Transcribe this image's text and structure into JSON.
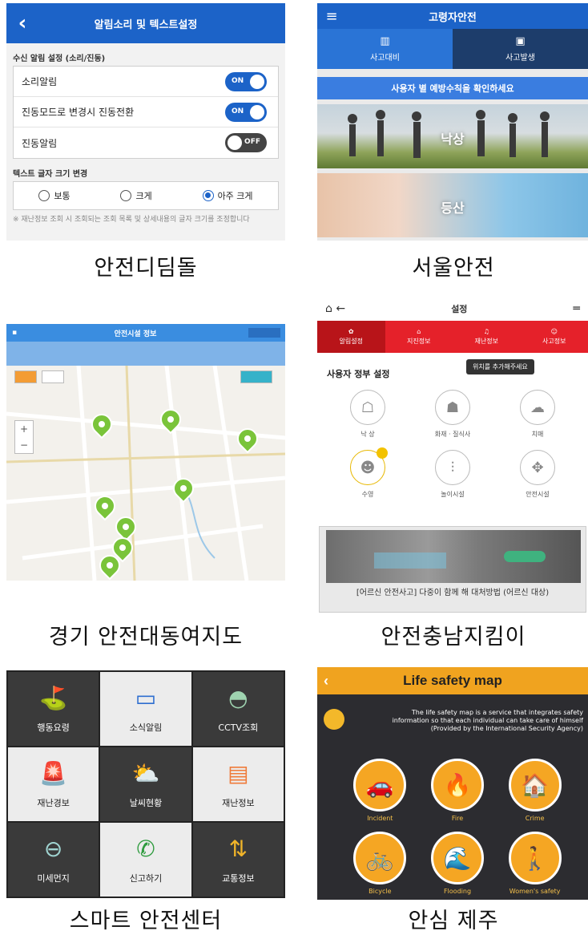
{
  "captions": {
    "p1": "안전디딤돌",
    "p2": "서울안전",
    "p3": "경기 안전대동여지도",
    "p4": "안전충남지킴이",
    "p5": "스마트 안전센터",
    "p6": "안심 제주"
  },
  "p1": {
    "title": "알림소리 및 텍스트설정",
    "section1": "수신 알림 설정 (소리/진동)",
    "rows": [
      {
        "label": "소리알림",
        "state": "ON"
      },
      {
        "label": "진동모드로 변경시 진동전환",
        "state": "ON"
      },
      {
        "label": "진동알림",
        "state": "OFF"
      }
    ],
    "section2": "텍스트 글자 크기 변경",
    "radios": [
      "보통",
      "크게",
      "아주 크게"
    ],
    "note": "※ 재난정보 조회 시 조회되는 조회 목록 및 상세내용의 글자 크기를 조정합니다"
  },
  "p2": {
    "title": "고령자안전",
    "tabs": [
      "사고대비",
      "사고발생"
    ],
    "notice": "사용자 별 예방수칙을 확인하세요",
    "cards": [
      "낙상",
      "등산"
    ]
  },
  "p3": {
    "title": "안전시설 정보"
  },
  "p4": {
    "title": "설정",
    "menu": [
      "알림설정",
      "지진정보",
      "재난정보",
      "사고정보"
    ],
    "tooltip": "위치를 추가해주세요",
    "heading": "사용자 정부 설정",
    "items": [
      "낙 상",
      "화재 · 질식사",
      "치매",
      "수영",
      "놀이시설",
      "안전시설"
    ],
    "photo_caption": "[어르신 안전사고] 다중이 함께 해 대처방법 (어르신 대상)"
  },
  "p5": {
    "tiles": [
      {
        "label": "행동요령",
        "icon": "map-pin-icon",
        "glyph": "⛳",
        "color": "#43a047",
        "style": "dark"
      },
      {
        "label": "소식알림",
        "icon": "card-icon",
        "glyph": "▭",
        "color": "#2f6fd0",
        "style": "light"
      },
      {
        "label": "CCTV조회",
        "icon": "cctv-icon",
        "glyph": "◓",
        "color": "#9fd3b0",
        "style": "dark"
      },
      {
        "label": "재난경보",
        "icon": "siren-icon",
        "glyph": "🚨",
        "color": "#e53935",
        "style": "light"
      },
      {
        "label": "날씨현황",
        "icon": "weather-icon",
        "glyph": "⛅",
        "color": "#f5c542",
        "style": "dark"
      },
      {
        "label": "재난정보",
        "icon": "document-icon",
        "glyph": "▤",
        "color": "#ef7b3a",
        "style": "light"
      },
      {
        "label": "미세먼지",
        "icon": "mask-icon",
        "glyph": "⊖",
        "color": "#9fd3d0",
        "style": "dark"
      },
      {
        "label": "신고하기",
        "icon": "phone-icon",
        "glyph": "✆",
        "color": "#2e9b3e",
        "style": "light"
      },
      {
        "label": "교통정보",
        "icon": "bus-icon",
        "glyph": "⇅",
        "color": "#f0b429",
        "style": "dark"
      }
    ]
  },
  "p6": {
    "title": "Life safety map",
    "desc": "The life safety map is a service that integrates safety information so that each individual can take care of himself (Provided by the International Security Agency)",
    "items": [
      {
        "label": "Incident",
        "glyph": "🚗"
      },
      {
        "label": "Fire",
        "glyph": "🔥"
      },
      {
        "label": "Crime",
        "glyph": "🏠"
      },
      {
        "label": "Bicycle",
        "glyph": "🚲"
      },
      {
        "label": "Flooding",
        "glyph": "🌊"
      },
      {
        "label": "Women's safety",
        "glyph": "🚶"
      }
    ],
    "accent": "#f5a623"
  }
}
